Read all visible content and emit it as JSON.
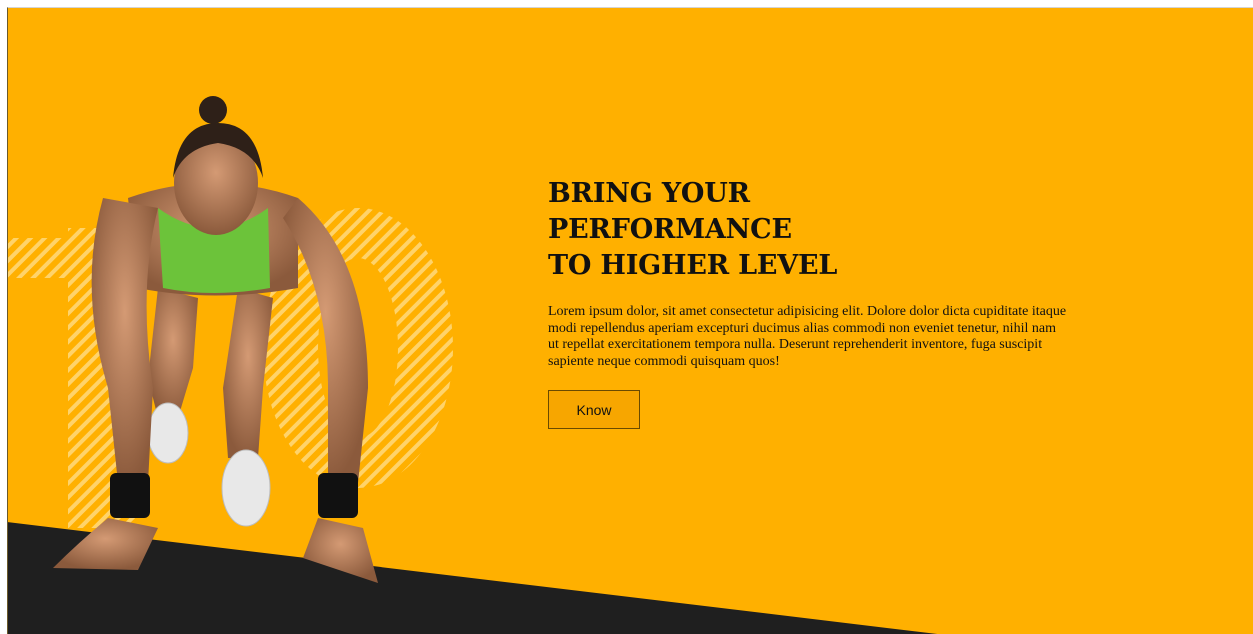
{
  "colors": {
    "background": "#ffb000",
    "floor": "#1f1f1f",
    "accent_stripes": "#ffd36a",
    "text": "#111111"
  },
  "hero": {
    "headline_lines": [
      "BRING YOUR",
      "PERFORMANCE",
      "TO HIGHER LEVEL"
    ],
    "body": "Lorem ipsum dolor, sit amet consectetur adipisicing elit. Dolore dolor dicta cupiditate itaque modi repellendus aperiam excepturi ducimus alias commodi non eveniet tenetur, nihil nam ut repellat exercitationem tempora nulla. Deserunt reprehenderit inventore, fuga suscipit sapiente neque commodi quisquam quos!",
    "button_label": "Know"
  },
  "decoration": {
    "background_number": "10"
  }
}
